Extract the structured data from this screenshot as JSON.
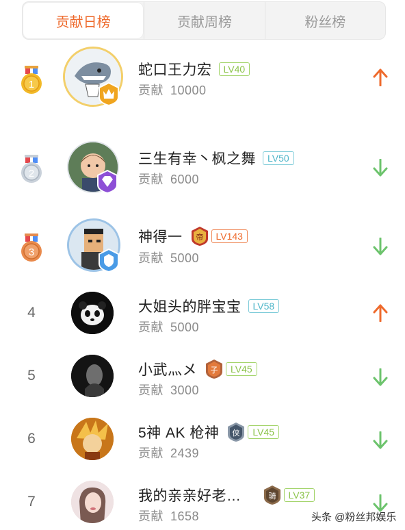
{
  "tabs": [
    {
      "label": "贡献日榜",
      "active": true
    },
    {
      "label": "贡献周榜",
      "active": false
    },
    {
      "label": "粉丝榜",
      "active": false
    }
  ],
  "contrib_label": "贡献",
  "rows": [
    {
      "rank": "1",
      "name": "蛇口王力宏",
      "level": "LV40",
      "contribution": "10000",
      "trend": "up"
    },
    {
      "rank": "2",
      "name": "三生有幸丶枫之舞",
      "level": "LV50",
      "contribution": "6000",
      "trend": "down"
    },
    {
      "rank": "3",
      "name": "神得一",
      "level": "LV143",
      "contribution": "5000",
      "trend": "down"
    },
    {
      "rank": "4",
      "name": "大姐头的胖宝宝",
      "level": "LV58",
      "contribution": "5000",
      "trend": "up"
    },
    {
      "rank": "5",
      "name": "小武灬メ",
      "level": "LV45",
      "contribution": "3000",
      "trend": "down"
    },
    {
      "rank": "6",
      "name": "5神 AK 枪神",
      "level": "LV45",
      "contribution": "2439",
      "trend": "down"
    },
    {
      "rank": "7",
      "name": "我的亲亲好老…",
      "level": "LV37",
      "contribution": "1658",
      "trend": "down"
    }
  ],
  "badge_glyphs": {
    "row3": "帝",
    "row5": "子",
    "row6": "侠",
    "row7": "骑"
  },
  "watermark": "头条 @粉丝邦娱乐",
  "colors": {
    "accent": "#ee6a2c",
    "up": "#ee6a2c",
    "down": "#6cc36c",
    "lv_green": "#8bc34a",
    "lv_teal": "#4fb6c9"
  }
}
